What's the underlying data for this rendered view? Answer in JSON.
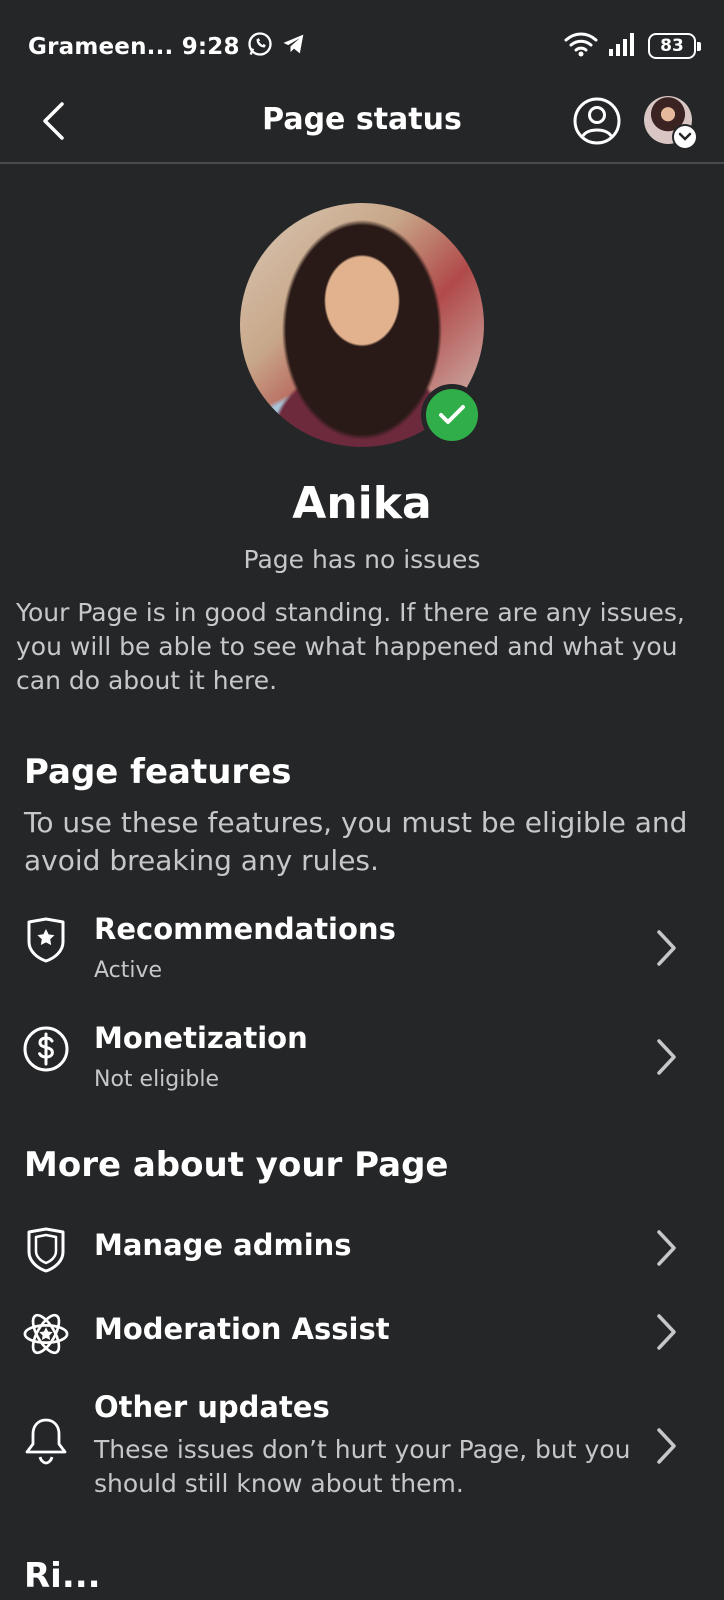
{
  "status_bar": {
    "carrier_time": "Grameen... 9:28",
    "battery": "83"
  },
  "header": {
    "title": "Page status"
  },
  "profile": {
    "name": "Anika",
    "status": "Page has no issues",
    "description": "Your Page is in good standing. If there are any issues, you will be able to see what happened and what you can do about it here."
  },
  "page_features": {
    "title": "Page features",
    "subtitle": "To use these features, you must be eligible and avoid breaking any rules.",
    "items": [
      {
        "label": "Recommendations",
        "sub": "Active",
        "icon": "shield-star-icon"
      },
      {
        "label": "Monetization",
        "sub": "Not eligible",
        "icon": "dollar-circle-icon"
      }
    ]
  },
  "more_about": {
    "title": "More about your Page",
    "items": [
      {
        "label": "Manage admins",
        "icon": "shield-icon"
      },
      {
        "label": "Moderation Assist",
        "icon": "atom-star-icon"
      },
      {
        "label": "Other updates",
        "desc": "These issues don’t hurt your Page, but you should still know about them.",
        "icon": "bell-icon"
      }
    ]
  },
  "cut_off_heading": "Ri..."
}
